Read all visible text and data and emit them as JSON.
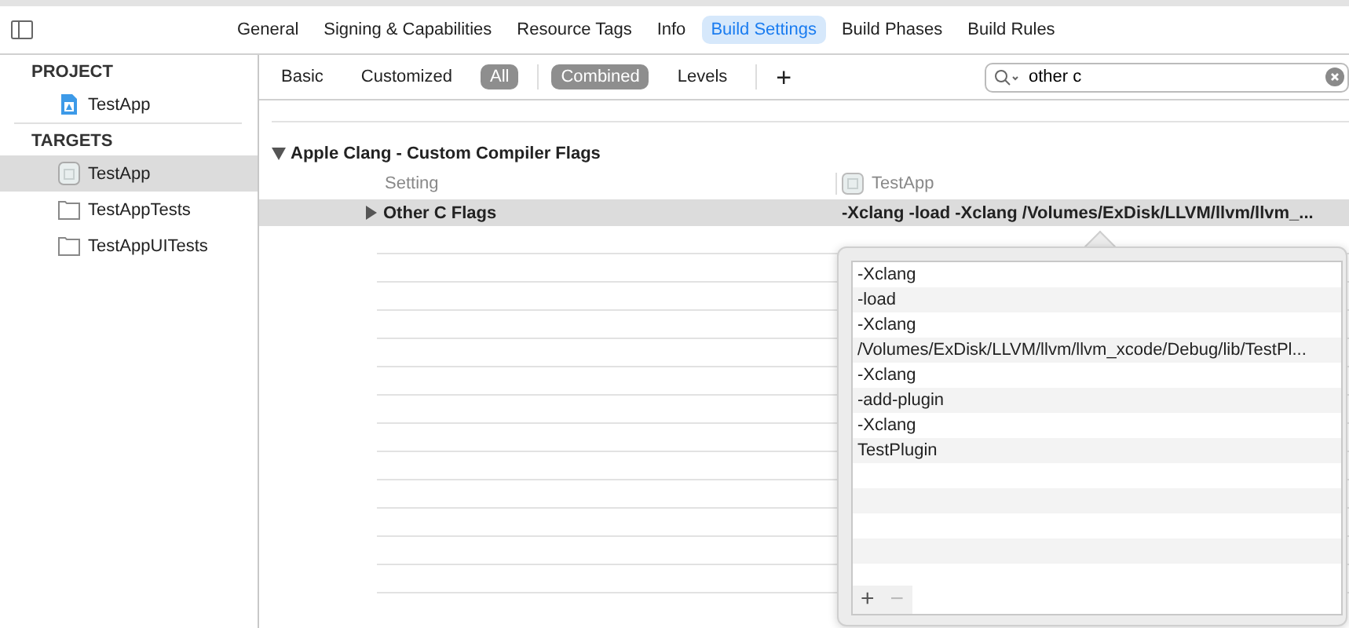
{
  "tabs": [
    {
      "label": "General",
      "selected": false
    },
    {
      "label": "Signing & Capabilities",
      "selected": false
    },
    {
      "label": "Resource Tags",
      "selected": false
    },
    {
      "label": "Info",
      "selected": false
    },
    {
      "label": "Build Settings",
      "selected": true
    },
    {
      "label": "Build Phases",
      "selected": false
    },
    {
      "label": "Build Rules",
      "selected": false
    }
  ],
  "sidebar": {
    "sections": [
      {
        "heading": "PROJECT",
        "items": [
          {
            "label": "TestApp",
            "kind": "project",
            "selected": false
          }
        ]
      },
      {
        "heading": "TARGETS",
        "items": [
          {
            "label": "TestApp",
            "kind": "app",
            "selected": true
          },
          {
            "label": "TestAppTests",
            "kind": "bundle",
            "selected": false
          },
          {
            "label": "TestAppUITests",
            "kind": "bundle",
            "selected": false
          }
        ]
      }
    ]
  },
  "filters": [
    {
      "label": "Basic",
      "selected": false
    },
    {
      "label": "Customized",
      "selected": false
    },
    {
      "label": "All",
      "selected": true
    }
  ],
  "views": [
    {
      "label": "Combined",
      "selected": true
    },
    {
      "label": "Levels",
      "selected": false
    }
  ],
  "add_button": "+",
  "search": {
    "value": "other c"
  },
  "section": {
    "title": "Apple Clang - Custom Compiler Flags",
    "expanded": true,
    "column_setting": "Setting",
    "column_target": "TestApp",
    "rows": [
      {
        "name": "Other C Flags",
        "value": "-Xclang -load -Xclang /Volumes/ExDisk/LLVM/llvm/llvm_...",
        "expanded": false,
        "selected": true
      }
    ]
  },
  "popover": {
    "items": [
      "-Xclang",
      "-load",
      "-Xclang",
      "/Volumes/ExDisk/LLVM/llvm/llvm_xcode/Debug/lib/TestPl...",
      "-Xclang",
      "-add-plugin",
      "-Xclang",
      "TestPlugin"
    ],
    "add": "+",
    "remove": "−"
  }
}
